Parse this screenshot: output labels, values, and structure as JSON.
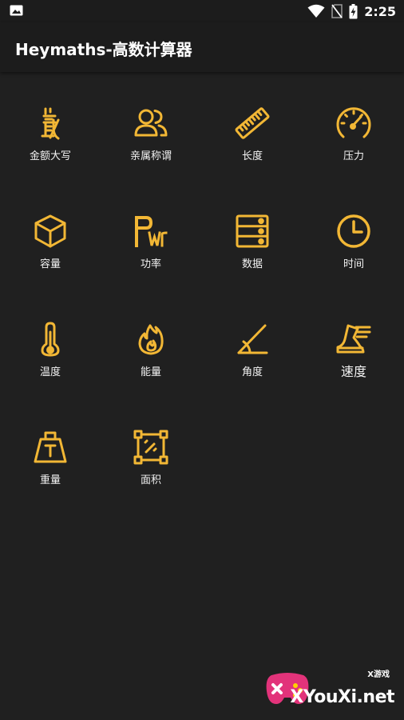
{
  "status_bar": {
    "time": "2:25",
    "icons": [
      "image-notification-icon",
      "wifi-icon",
      "no-sim-icon",
      "battery-charging-icon"
    ]
  },
  "app_bar": {
    "title": "Heymaths-高数计算器"
  },
  "colors": {
    "accent": "#F2B735",
    "background": "#202020",
    "app_bar": "#1C1C1C"
  },
  "converters": [
    {
      "label": "金额大写",
      "icon": "currency-yuan-icon"
    },
    {
      "label": "亲属称谓",
      "icon": "people-icon"
    },
    {
      "label": "长度",
      "icon": "ruler-icon"
    },
    {
      "label": "压力",
      "icon": "gauge-icon"
    },
    {
      "label": "容量",
      "icon": "cube-icon"
    },
    {
      "label": "功率",
      "icon": "power-pwr-icon"
    },
    {
      "label": "数据",
      "icon": "server-icon"
    },
    {
      "label": "时间",
      "icon": "clock-icon"
    },
    {
      "label": "温度",
      "icon": "thermometer-icon"
    },
    {
      "label": "能量",
      "icon": "fire-icon"
    },
    {
      "label": "角度",
      "icon": "angle-icon"
    },
    {
      "label": "速度",
      "icon": "speed-shoe-icon"
    },
    {
      "label": "重量",
      "icon": "weight-icon"
    },
    {
      "label": "面积",
      "icon": "area-icon"
    }
  ],
  "watermark": {
    "brand": "XYouXi.net",
    "small": "X游戏"
  }
}
